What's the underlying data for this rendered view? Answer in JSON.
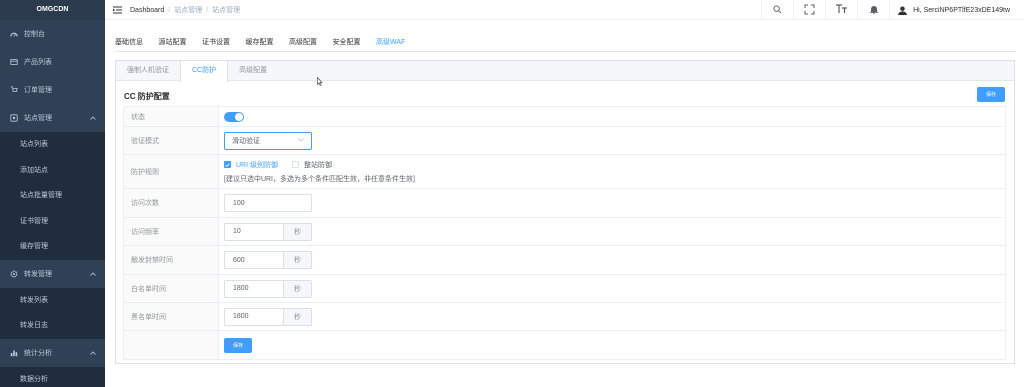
{
  "sidebar": {
    "logo": "OMGCDN",
    "items": [
      {
        "label": "控制台",
        "icon": "dashboard-icon"
      },
      {
        "label": "产品列表",
        "icon": "product-icon"
      },
      {
        "label": "订单管理",
        "icon": "cart-icon"
      },
      {
        "label": "站点管理",
        "icon": "site-icon",
        "expanded": true,
        "children": [
          "站点列表",
          "添加站点",
          "站点批量管理",
          "证书管理",
          "缓存管理"
        ]
      },
      {
        "label": "转发管理",
        "icon": "gear-icon",
        "expanded": true,
        "children": [
          "转发列表",
          "转发日志"
        ]
      },
      {
        "label": "统计分析",
        "icon": "chart-icon",
        "expanded": true,
        "children": [
          "数据分析"
        ]
      }
    ]
  },
  "header": {
    "breadcrumb": [
      "Dashboard",
      "站点管理",
      "站点管理"
    ],
    "user": "Hi, SerciNP6PTlfE23xDE149tw"
  },
  "tabs": [
    "基础信息",
    "源站配置",
    "证书设置",
    "缓存配置",
    "高级配置",
    "安全配置",
    "高级WAF"
  ],
  "active_tab": 6,
  "subtabs": [
    "强制人机验证",
    "CC防护",
    "高级配置"
  ],
  "active_subtab": 1,
  "card": {
    "title": "CC 防护配置",
    "save_label": "保存"
  },
  "form": {
    "status_label": "状态",
    "status_on": true,
    "mode_label": "验证模式",
    "mode_value": "滑动验证",
    "rule_label": "防护规则",
    "rule_opt1": "URI 级别防御",
    "rule_opt2": "整站防御",
    "rule_hint": "[建议只选中URI，多选为多个条件匹配生效，非任意条件生效]",
    "visits_label": "访问次数",
    "visits_value": "100",
    "freq_label": "访问频率",
    "freq_value": "10",
    "trigger_label": "触发封禁时间",
    "trigger_value": "600",
    "white_label": "白名单时间",
    "white_value": "1800",
    "black_label": "黑名单时间",
    "black_value": "1800",
    "unit": "秒",
    "save_label": "保存"
  },
  "colors": {
    "accent": "#409eff",
    "sidebar_bg": "#304156",
    "submenu_bg": "#1f2d3d"
  }
}
